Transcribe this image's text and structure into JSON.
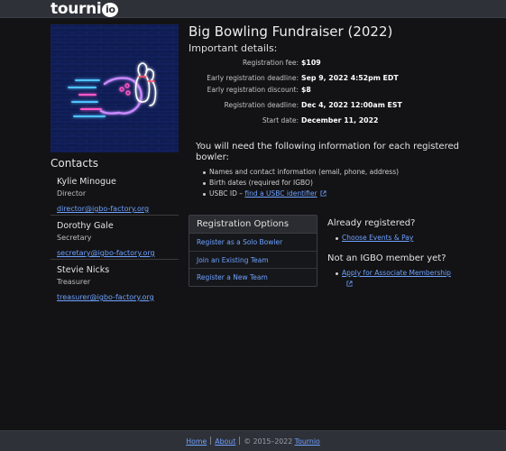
{
  "header": {
    "logo_text": "tourni",
    "logo_badge": "io"
  },
  "event": {
    "title": "Big Bowling Fundraiser (2022)",
    "details_heading": "Important details:",
    "details": [
      {
        "label": "Registration fee:",
        "value": "$109"
      },
      {
        "label": "Early registration deadline:",
        "value": "Sep 9, 2022 4:52pm EDT"
      },
      {
        "label": "Early registration discount:",
        "value": "$8"
      },
      {
        "label": "Registration deadline:",
        "value": "Dec 4, 2022 12:00am EST"
      },
      {
        "label": "Start date:",
        "value": "December 11, 2022"
      }
    ]
  },
  "requirements": {
    "intro": "You will need the following information for each registered bowler:",
    "items": [
      "Names and contact information (email, phone, address)",
      "Birth dates (required for IGBO)"
    ],
    "usbc_prefix": "USBC ID – ",
    "usbc_link": "find a USBC identifier"
  },
  "contacts": {
    "title": "Contacts",
    "people": [
      {
        "name": "Kylie Minogue",
        "role": "Director",
        "email": "director@igbo-factory.org"
      },
      {
        "name": "Dorothy Gale",
        "role": "Secretary",
        "email": "secretary@igbo-factory.org"
      },
      {
        "name": "Stevie Nicks",
        "role": "Treasurer",
        "email": "treasurer@igbo-factory.org"
      }
    ]
  },
  "registration_options": {
    "heading": "Registration Options",
    "items": [
      "Register as a Solo Bowler",
      "Join an Existing Team",
      "Register a New Team"
    ]
  },
  "already_registered": {
    "heading": "Already registered?",
    "link": "Choose Events & Pay"
  },
  "membership": {
    "heading": "Not an IGBO member yet?",
    "link": "Apply for Associate Membership"
  },
  "footer": {
    "home": "Home",
    "about": "About",
    "copyright": "© 2015–2022",
    "brand": "Tournio"
  },
  "colors": {
    "link": "#6ea1ff",
    "background": "#131315",
    "bar": "#2e3138",
    "neon_blue": "#3aa0ff",
    "neon_pink": "#ff4fb0"
  }
}
